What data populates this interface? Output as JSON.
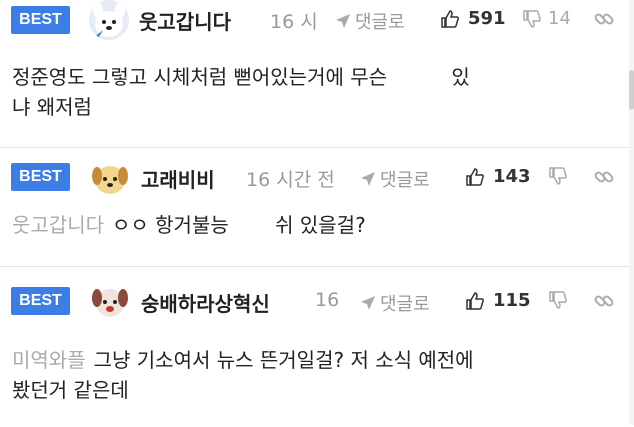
{
  "comments": [
    {
      "badge": "BEST",
      "avatar": "dog-avatar",
      "nickname": "웃고갑니다",
      "time": "16 시",
      "reply_label": "댓글로",
      "likes": "591",
      "dislikes": "14",
      "mention": "",
      "text_line1_a": "정준영도 그렇고 시체처럼 뻗어있는거에 무슨",
      "text_line1_b": "있",
      "text_line2": "냐 왜저럼"
    },
    {
      "badge": "BEST",
      "avatar": "puppy-avatar",
      "nickname": "고래비비",
      "time": "16 시간 전",
      "reply_label": "댓글로",
      "likes": "143",
      "dislikes": "",
      "mention": "웃고갑니다",
      "text_a": "ㅇㅇ 항거불능 ",
      "text_b": "쉬 있을걸?"
    },
    {
      "badge": "BEST",
      "avatar": "dog-avatar-2",
      "nickname": "숭배하라상혁신",
      "time": "16",
      "reply_label": "댓글로",
      "likes": "115",
      "dislikes": "",
      "mention": "미역와플",
      "text_line1": "그냥 기소여서 뉴스 뜬거일걸? 저 소식 예전에",
      "text_line2": "봤던거 같은데"
    }
  ],
  "colors": {
    "badge_bg": "#3d7ee6",
    "muted_text": "#999999"
  }
}
